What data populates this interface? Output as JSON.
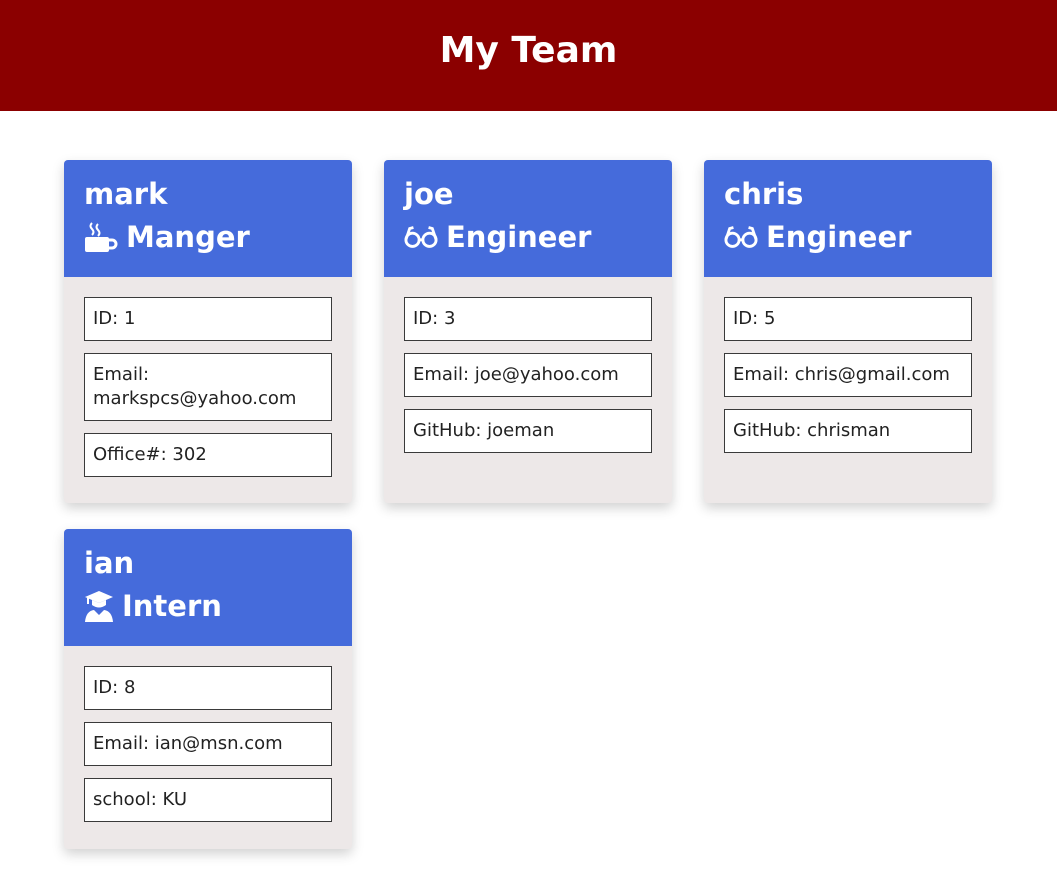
{
  "header": {
    "title": "My Team"
  },
  "colors": {
    "header_bg": "#8b0000",
    "card_head_bg": "#456bdb",
    "card_body_bg": "#ede8e8"
  },
  "cards": [
    {
      "name": "mark",
      "role": "Manger",
      "role_icon": "mug-icon",
      "fields": [
        "ID: 1",
        "Email: markspcs@yahoo.com",
        "Office#: 302"
      ]
    },
    {
      "name": "joe",
      "role": "Engineer",
      "role_icon": "glasses-icon",
      "fields": [
        "ID: 3",
        "Email: joe@yahoo.com",
        "GitHub: joeman"
      ]
    },
    {
      "name": "chris",
      "role": "Engineer",
      "role_icon": "glasses-icon",
      "fields": [
        "ID: 5",
        "Email: chris@gmail.com",
        "GitHub: chrisman"
      ]
    },
    {
      "name": "ian",
      "role": "Intern",
      "role_icon": "graduate-icon",
      "fields": [
        "ID: 8",
        "Email: ian@msn.com",
        "school: KU"
      ]
    }
  ]
}
